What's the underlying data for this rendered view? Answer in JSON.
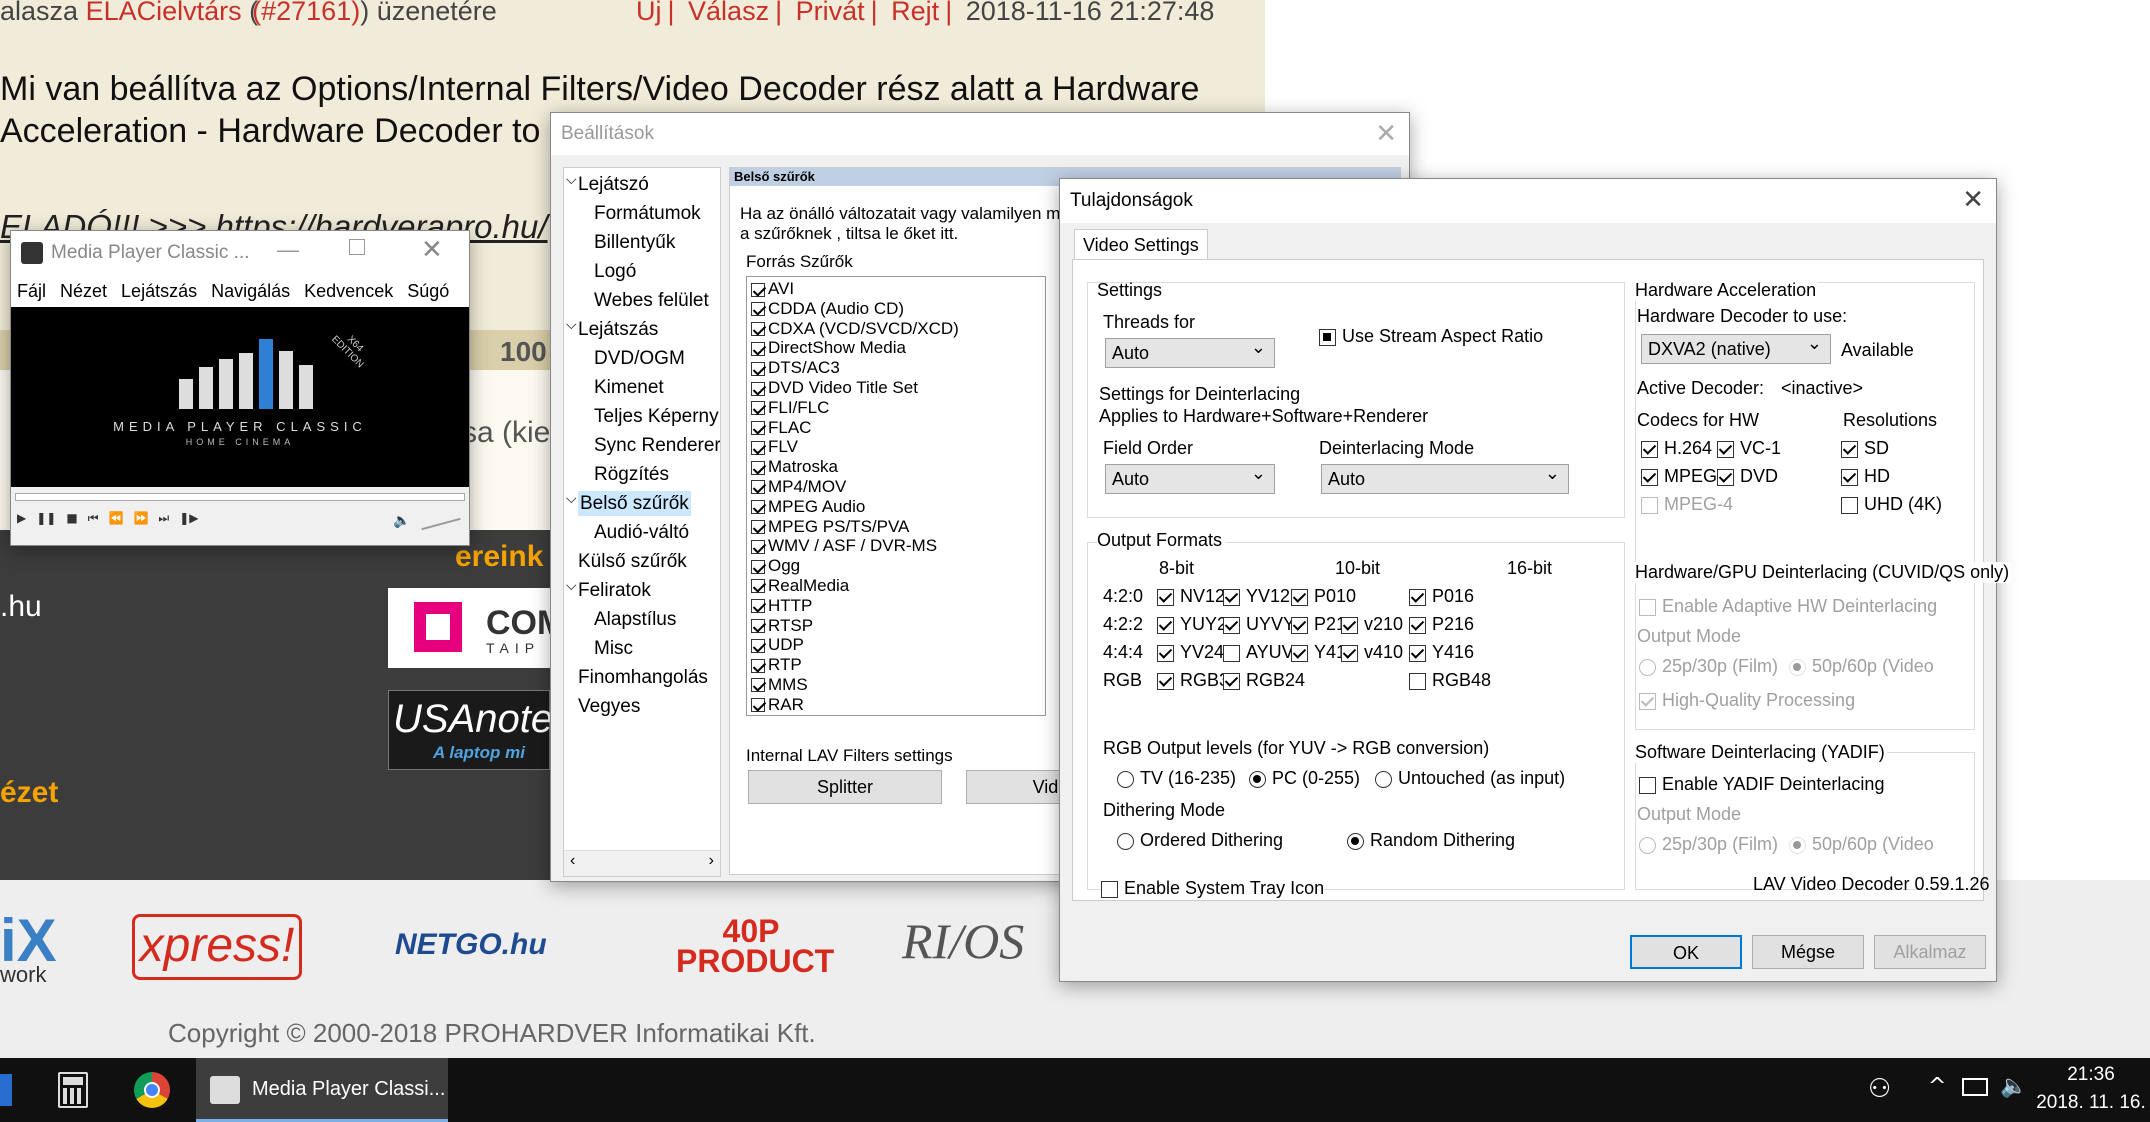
{
  "forum": {
    "reply_prefix": "alasza",
    "reply_user": "ELACielvtárs",
    "reply_id": "(#27161)",
    "reply_suffix": "üzenetére",
    "links": [
      "Új",
      "Válasz",
      "Privát",
      "Rejt"
    ],
    "timestamp": "2018-11-16 21:27:48",
    "body_line1": "Mi van beállítva az Options/Internal Filters/Video Decoder rész alatt a Hardware",
    "body_line2": "Acceleration - Hardware Decoder to u",
    "sale_text": "ELADÓ!!! >>> https://hardverapro.hu/",
    "num_100": "100",
    "kier": "sa (kier",
    "ereink": "ereink",
    "hu": ".hu",
    "nezet": "ézet",
    "ad1": "COM",
    "ad1_sub": "TAIP",
    "ad2": "USAnote",
    "ad2_sub": "A laptop mi",
    "logos": [
      "iX",
      "work",
      "xpress!",
      "NETGO.hu",
      "40P PRODUCT",
      "RI/OS"
    ],
    "copyright": "Copyright © 2000-2018 PROHARDVER Informatikai Kft."
  },
  "mpc": {
    "title": "Media Player Classic ...",
    "menu": [
      "Fájl",
      "Nézet",
      "Lejátszás",
      "Navigálás",
      "Kedvencek",
      "Súgó"
    ],
    "logo_main": "MEDIA PLAYER CLASSIC",
    "logo_sub": "HOME CINEMA",
    "edition": "X64 EDITION",
    "controls": [
      "▶",
      "❚❚",
      "■",
      "⏮",
      "⏪",
      "⏩",
      "⏭",
      "❚▶"
    ]
  },
  "settings": {
    "title": "Beállítások",
    "tree": [
      {
        "label": "Lejátszó",
        "level": 0,
        "expander": "⌵"
      },
      {
        "label": "Formátumok",
        "level": 1
      },
      {
        "label": "Billentyűk",
        "level": 1
      },
      {
        "label": "Logó",
        "level": 1
      },
      {
        "label": "Webes felület",
        "level": 1
      },
      {
        "label": "Lejátszás",
        "level": 0,
        "expander": "⌵"
      },
      {
        "label": "DVD/OGM",
        "level": 1
      },
      {
        "label": "Kimenet",
        "level": 1
      },
      {
        "label": "Teljes Képerny",
        "level": 1
      },
      {
        "label": "Sync Renderer",
        "level": 1
      },
      {
        "label": "Rögzítés",
        "level": 1
      },
      {
        "label": "Belső szűrők",
        "level": 0,
        "expander": "⌵",
        "selected": true
      },
      {
        "label": "Audió-váltó",
        "level": 1
      },
      {
        "label": "Külső szűrők",
        "level": 0
      },
      {
        "label": "Feliratok",
        "level": 0,
        "expander": "⌵"
      },
      {
        "label": "Alapstílus",
        "level": 1
      },
      {
        "label": "Misc",
        "level": 1
      },
      {
        "label": "Finomhangolás",
        "level": 0
      },
      {
        "label": "Vegyes",
        "level": 0
      }
    ],
    "section_header": "Belső szűrők",
    "description1": "Ha az önálló változatait vagy valamilyen ma",
    "description2": "a szűrőknek , tiltsa le őket itt.",
    "source_filters_label": "Forrás Szűrők",
    "filters": [
      "AVI",
      "CDDA (Audio CD)",
      "CDXA (VCD/SVCD/XCD)",
      "DirectShow Media",
      "DTS/AC3",
      "DVD Video Title Set",
      "FLI/FLC",
      "FLAC",
      "FLV",
      "Matroska",
      "MP4/MOV",
      "MPEG Audio",
      "MPEG PS/TS/PVA",
      "WMV / ASF / DVR-MS",
      "Ogg",
      "RealMedia",
      "HTTP",
      "RTSP",
      "UDP",
      "RTP",
      "MMS",
      "RAR"
    ],
    "lav_label": "Internal LAV Filters settings",
    "splitter_button": "Splitter",
    "video_button": "Video d"
  },
  "props": {
    "title": "Tulajdonságok",
    "tab": "Video Settings",
    "settings_group": "Settings",
    "threads_label": "Threads for",
    "threads_value": "Auto",
    "use_stream_aspect": "Use Stream Aspect Ratio",
    "deint_settings1": "Settings for Deinterlacing",
    "deint_settings2": "Applies to Hardware+Software+Renderer",
    "field_order_label": "Field Order",
    "field_order_value": "Auto",
    "deint_mode_label": "Deinterlacing Mode",
    "deint_mode_value": "Auto",
    "output_formats_group": "Output Formats",
    "col_8bit": "8-bit",
    "col_10bit": "10-bit",
    "col_16bit": "16-bit",
    "rows": [
      {
        "label": "4:2:0",
        "items": [
          {
            "t": "NV12",
            "on": true
          },
          {
            "t": "YV12",
            "on": true
          },
          {
            "t": "P010",
            "on": true
          },
          {
            "t": "",
            "on": false,
            "hidden": true
          },
          {
            "t": "P016",
            "on": true
          }
        ]
      },
      {
        "label": "4:2:2",
        "items": [
          {
            "t": "YUY2",
            "on": true
          },
          {
            "t": "UYVY",
            "on": true
          },
          {
            "t": "P210",
            "on": true
          },
          {
            "t": "v210",
            "on": true
          },
          {
            "t": "P216",
            "on": true
          }
        ]
      },
      {
        "label": "4:4:4",
        "items": [
          {
            "t": "YV24",
            "on": true
          },
          {
            "t": "AYUV",
            "on": false
          },
          {
            "t": "Y410",
            "on": true
          },
          {
            "t": "v410",
            "on": true
          },
          {
            "t": "Y416",
            "on": true
          }
        ]
      },
      {
        "label": "RGB",
        "items": [
          {
            "t": "RGB32",
            "on": true
          },
          {
            "t": "RGB24",
            "on": true
          },
          {
            "t": "",
            "on": false,
            "hidden": true
          },
          {
            "t": "",
            "on": false,
            "hidden": true
          },
          {
            "t": "RGB48",
            "on": false
          }
        ]
      }
    ],
    "rgb_levels_label": "RGB Output levels (for YUV -> RGB conversion)",
    "rgb_tv": "TV (16-235)",
    "rgb_pc": "PC (0-255)",
    "rgb_untouched": "Untouched (as input)",
    "dithering_label": "Dithering Mode",
    "dither_ordered": "Ordered Dithering",
    "dither_random": "Random Dithering",
    "system_tray": "Enable System Tray Icon",
    "hw_group": "Hardware Acceleration",
    "hw_decoder_label": "Hardware Decoder to use:",
    "hw_decoder_value": "DXVA2 (native)",
    "hw_available": "Available",
    "active_decoder_label": "Active Decoder:",
    "active_decoder_value": "<inactive>",
    "codecs_label": "Codecs for HW",
    "resolutions_label": "Resolutions",
    "codecs": [
      {
        "t": "H.264",
        "on": true,
        "dis": false
      },
      {
        "t": "VC-1",
        "on": true,
        "dis": false
      },
      {
        "t": "MPEG-2",
        "on": true,
        "dis": false
      },
      {
        "t": "DVD",
        "on": true,
        "dis": false
      },
      {
        "t": "MPEG-4",
        "on": false,
        "dis": true
      }
    ],
    "resolutions": [
      {
        "t": "SD",
        "on": true
      },
      {
        "t": "HD",
        "on": true
      },
      {
        "t": "UHD (4K)",
        "on": false
      }
    ],
    "gpu_deint_group": "Hardware/GPU Deinterlacing (CUVID/QS only)",
    "adaptive_hw": "Enable Adaptive HW Deinterlacing",
    "output_mode": "Output Mode",
    "mode_25": "25p/30p (Film)",
    "mode_50": "50p/60p (Video",
    "hq_processing": "High-Quality Processing",
    "sw_deint_group": "Software Deinterlacing (YADIF)",
    "yadif": "Enable YADIF Deinterlacing",
    "sw_output_mode": "Output Mode",
    "sw_mode_25": "25p/30p (Film)",
    "sw_mode_50": "50p/60p (Video",
    "version": "LAV Video Decoder 0.59.1.26",
    "ok": "OK",
    "cancel": "Mégse",
    "apply": "Alkalmaz"
  },
  "taskbar": {
    "app_label": "Media Player Classi...",
    "time": "21:36",
    "date": "2018. 11. 16."
  }
}
